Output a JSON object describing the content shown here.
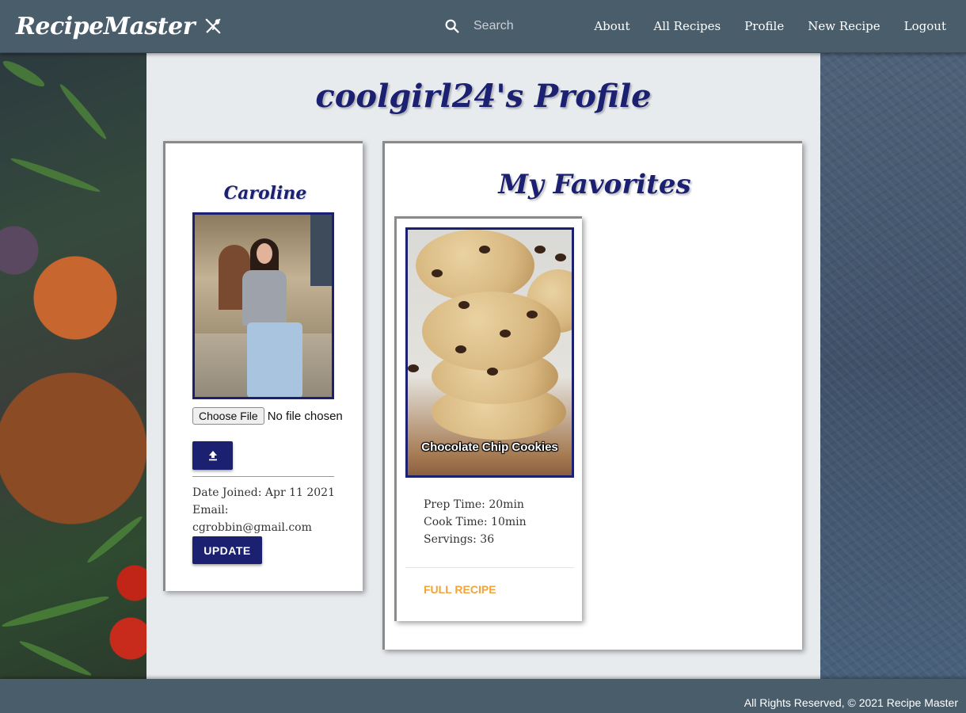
{
  "navbar": {
    "brand": "RecipeMaster",
    "search_placeholder": "Search",
    "links": [
      "About",
      "All Recipes",
      "Profile",
      "New Recipe",
      "Logout"
    ]
  },
  "page": {
    "title": "coolgirl24's Profile"
  },
  "profile": {
    "name": "Caroline",
    "file_button_label": "Choose File",
    "file_status": "No file chosen",
    "date_joined": "Date Joined: Apr 11 2021",
    "email_label": "Email:",
    "email": "cgrobbin@gmail.com",
    "update_label": "UPDATE"
  },
  "favorites": {
    "title": "My Favorites",
    "recipes": [
      {
        "name": "Chocolate Chip Cookies",
        "prep_time": "Prep Time: 20min",
        "cook_time": "Cook Time: 10min",
        "servings": "Servings: 36",
        "link_label": "FULL RECIPE"
      }
    ]
  },
  "footer": {
    "text": "All Rights Reserved, © 2021 Recipe Master"
  },
  "colors": {
    "navbar": "#4a5d6b",
    "accent_navy": "#1b2070",
    "link_orange": "#f2a33a"
  }
}
